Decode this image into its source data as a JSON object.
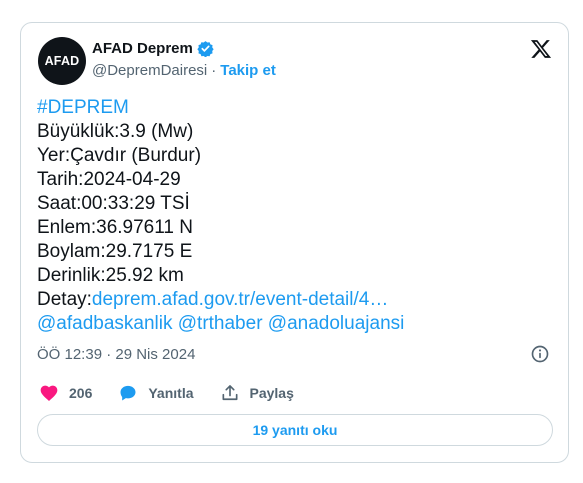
{
  "author": {
    "avatar_text": "AFAD",
    "display_name": "AFAD Deprem",
    "handle": "@DepremDairesi",
    "separator": "·",
    "follow_label": "Takip et"
  },
  "tweet": {
    "hashtag": "#DEPREM",
    "lines": [
      "Büyüklük:3.9 (Mw)",
      "Yer:Çavdır (Burdur)",
      "Tarih:2024-04-29",
      "Saat:00:33:29 TSİ",
      "Enlem:36.97611 N",
      "Boylam:29.7175 E",
      "Derinlik:25.92 km"
    ],
    "detail_label": "Detay:",
    "detail_link": "deprem.afad.gov.tr/event-detail/4…",
    "mentions": "@afadbaskanlik @trthaber @anadoluajansi"
  },
  "meta": {
    "timestamp": "ÖÖ 12:39 · 29 Nis 2024"
  },
  "actions": {
    "like_count": "206",
    "reply_label": "Yanıtla",
    "share_label": "Paylaş"
  },
  "replies_button": "19 yanıtı oku",
  "colors": {
    "accent": "#1d9bf0",
    "like": "#f91880",
    "text": "#0f1419",
    "muted": "#536471"
  },
  "icons": [
    "verified-badge-icon",
    "x-logo-icon",
    "info-icon",
    "heart-icon",
    "reply-bubble-icon",
    "share-icon"
  ]
}
